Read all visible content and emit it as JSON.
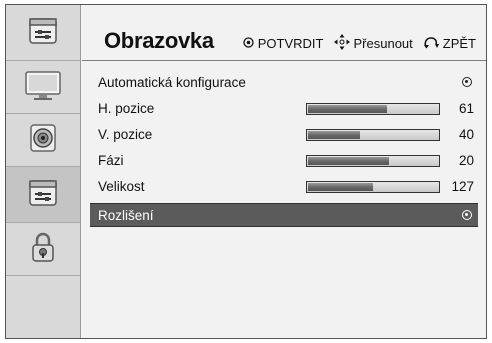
{
  "header": {
    "title": "Obrazovka",
    "hints": [
      {
        "icon": "ok-button-icon",
        "label": "POTVRDIT"
      },
      {
        "icon": "arrows-move-icon",
        "label": "Přesunout"
      },
      {
        "icon": "back-arrow-icon",
        "label": "ZPĚT"
      }
    ]
  },
  "sidebar": {
    "top_icon": "screen-settings-icon",
    "items": [
      {
        "icon": "tv-picture-icon",
        "active": false
      },
      {
        "icon": "speaker-audio-icon",
        "active": false
      },
      {
        "icon": "screen-settings-icon",
        "active": true
      },
      {
        "icon": "padlock-icon",
        "active": false
      }
    ]
  },
  "menu": {
    "items": [
      {
        "label": "Automatická konfigurace",
        "type": "radio",
        "selected": false
      },
      {
        "label": "H. pozice",
        "type": "slider",
        "value": "61",
        "level": 61
      },
      {
        "label": "V. pozice",
        "type": "slider",
        "value": "40",
        "level": 40
      },
      {
        "label": "Fázi",
        "type": "slider",
        "value": "20",
        "level": 20
      },
      {
        "label": "Velikost",
        "type": "slider",
        "value": "127",
        "level": 127
      },
      {
        "label": "Rozlišení",
        "type": "radio",
        "selected": true
      }
    ]
  },
  "colors": {
    "panel_bg": "#f2f2f2",
    "sidebar_bg": "#d9d9d9",
    "selected_row_bg": "#5b5b5b",
    "slider_fill": "#6a6a6a"
  }
}
